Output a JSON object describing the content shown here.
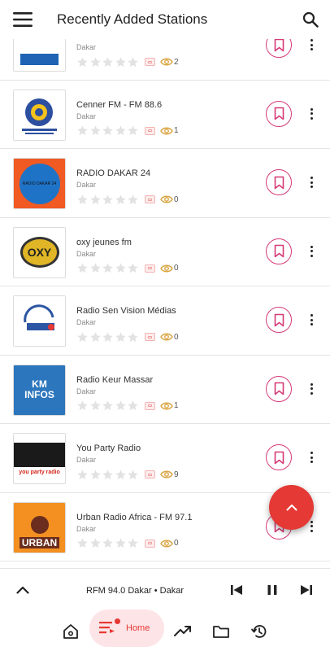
{
  "header": {
    "title": "Recently Added Stations"
  },
  "stations": [
    {
      "name": "",
      "location": "Dakar",
      "listeners": "2",
      "logo": "iradio"
    },
    {
      "name": "Cenner FM - FM 88.6",
      "location": "Dakar",
      "listeners": "1",
      "logo": "cenner"
    },
    {
      "name": "RADIO DAKAR 24",
      "location": "Dakar",
      "listeners": "0",
      "logo": "dakar24",
      "logo_text": "RADIO DAKAR 24"
    },
    {
      "name": "oxy jeunes fm",
      "location": "Dakar",
      "listeners": "0",
      "logo": "oxy",
      "logo_text": "OXY"
    },
    {
      "name": "Radio Sen Vision Médias",
      "location": "Dakar",
      "listeners": "0",
      "logo": "senvision"
    },
    {
      "name": "Radio Keur Massar",
      "location": "Dakar",
      "listeners": "1",
      "logo": "kminfos",
      "logo_text": "KM INFOS"
    },
    {
      "name": "You Party Radio",
      "location": "Dakar",
      "listeners": "9",
      "logo": "youparty",
      "logo_text": "you party radio"
    },
    {
      "name": "Urban Radio Africa - FM 97.1",
      "location": "Dakar",
      "listeners": "0",
      "logo": "urban",
      "logo_text": "URBAN"
    }
  ],
  "player": {
    "now_playing": "RFM 94.0 Dakar • Dakar"
  },
  "nav": {
    "home_label": "Home"
  },
  "colors": {
    "accent": "#e53935",
    "favorite": "#d63a78",
    "home_pill": "#fde4e6",
    "star": "#e2e2e2"
  },
  "icons": [
    "menu-icon",
    "search-icon",
    "bookmark-icon",
    "more-vert-icon",
    "star-icon",
    "record-icon",
    "eye-icon",
    "chevron-up-icon",
    "skip-previous-icon",
    "pause-icon",
    "skip-next-icon",
    "home-icon",
    "playlist-icon",
    "trending-icon",
    "folder-icon",
    "history-icon"
  ]
}
